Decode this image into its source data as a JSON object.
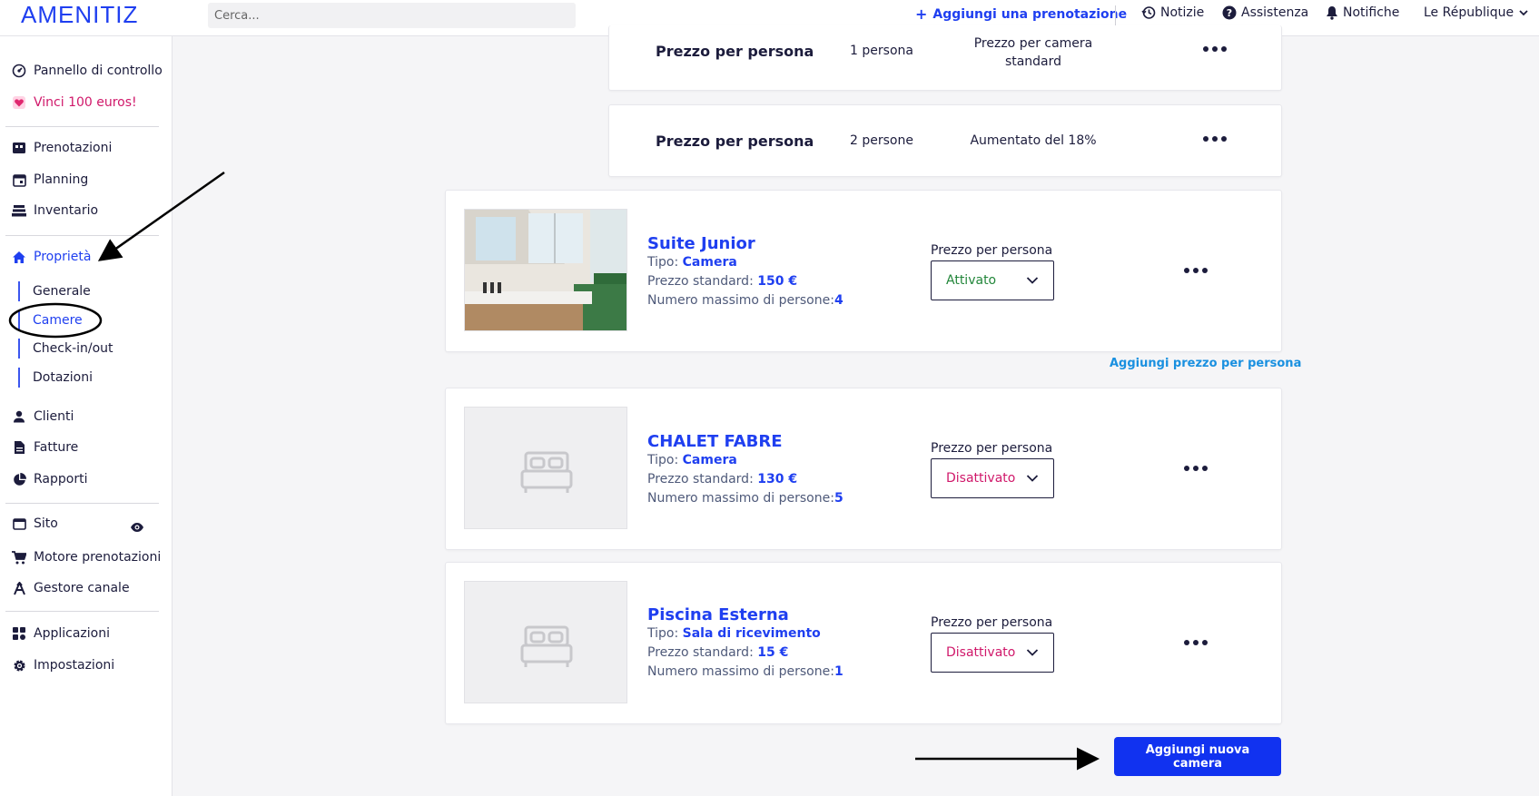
{
  "header": {
    "logo": "AMENITIZ",
    "search_placeholder": "Cerca...",
    "add_booking": "Aggiungi una prenotazione",
    "news": "Notizie",
    "help": "Assistenza",
    "notifications": "Notifiche",
    "property": "Le République"
  },
  "sidebar": {
    "items": [
      {
        "label": "Pannello di controllo",
        "icon": "gauge-icon"
      },
      {
        "label": "Vinci 100 euros!",
        "icon": "heart-icon"
      },
      {
        "label": "Prenotazioni",
        "icon": "bed-icon"
      },
      {
        "label": "Planning",
        "icon": "calendar-icon"
      },
      {
        "label": "Inventario",
        "icon": "stack-icon"
      },
      {
        "label": "Proprietà",
        "icon": "home-icon"
      },
      {
        "label": "Clienti",
        "icon": "user-icon"
      },
      {
        "label": "Fatture",
        "icon": "invoice-icon"
      },
      {
        "label": "Rapporti",
        "icon": "pie-icon"
      },
      {
        "label": "Sito",
        "icon": "browser-icon"
      },
      {
        "label": "Motore prenotazioni",
        "icon": "cart-icon"
      },
      {
        "label": "Gestore canale",
        "icon": "channel-icon"
      },
      {
        "label": "Applicazioni",
        "icon": "apps-icon"
      },
      {
        "label": "Impostazioni",
        "icon": "gear-icon"
      }
    ],
    "subitems": [
      "Generale",
      "Camere",
      "Check-in/out",
      "Dotazioni"
    ]
  },
  "price_rows": [
    {
      "label": "Prezzo per persona",
      "persons": "1 persona",
      "rule_line1": "Prezzo per camera",
      "rule_line2": "standard"
    },
    {
      "label": "Prezzo per persona",
      "persons": "2 persone",
      "rule_line1": "Aumentato del 18%",
      "rule_line2": ""
    }
  ],
  "rooms": [
    {
      "name": "Suite Junior",
      "type_label": "Tipo: ",
      "type": "Camera",
      "price_label": "Prezzo standard: ",
      "price": "150 €",
      "max_label": "Numero massimo di persone:",
      "max": "4",
      "select_label": "Prezzo per persona",
      "status": "Attivato"
    },
    {
      "name": "CHALET FABRE",
      "type_label": "Tipo: ",
      "type": "Camera",
      "price_label": "Prezzo standard: ",
      "price": "130 €",
      "max_label": "Numero massimo di persone:",
      "max": "5",
      "select_label": "Prezzo per persona",
      "status": "Disattivato"
    },
    {
      "name": "Piscina Esterna",
      "type_label": "Tipo: ",
      "type": "Sala di ricevimento",
      "price_label": "Prezzo standard: ",
      "price": "15 €",
      "max_label": "Numero massimo di persone:",
      "max": "1",
      "select_label": "Prezzo per persona",
      "status": "Disattivato"
    }
  ],
  "add_price_link": "Aggiungi prezzo per persona",
  "add_room_button": "Aggiungi nuova camera",
  "colors": {
    "accent": "#1f3ff0",
    "button": "#1132f0",
    "active": "#22863a",
    "inactive": "#d0186a",
    "link": "#1990e0"
  }
}
